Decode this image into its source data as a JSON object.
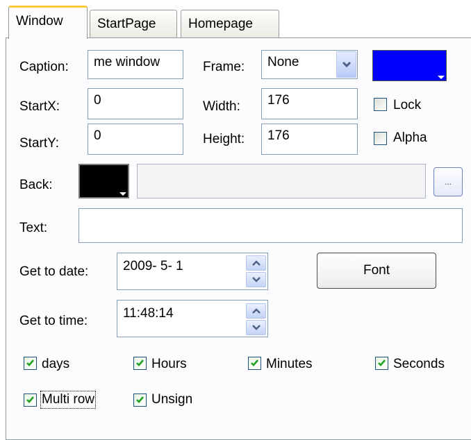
{
  "tabs": [
    {
      "label": "Window",
      "active": true
    },
    {
      "label": "StartPage",
      "active": false
    },
    {
      "label": "Homepage",
      "active": false
    }
  ],
  "caption": {
    "label": "Caption:",
    "value": "me window"
  },
  "frame": {
    "label": "Frame:",
    "selected": "None"
  },
  "frame_color": "#0000ff",
  "startx": {
    "label": "StartX:",
    "value": "0"
  },
  "starty": {
    "label": "StartY:",
    "value": "0"
  },
  "width": {
    "label": "Width:",
    "value": "176"
  },
  "height": {
    "label": "Height:",
    "value": "176"
  },
  "lock": {
    "label": "Lock",
    "checked": false
  },
  "alpha": {
    "label": "Alpha",
    "checked": false
  },
  "back": {
    "label": "Back:",
    "color": "#000000",
    "path": "",
    "browse_label": "..."
  },
  "text": {
    "label": "Text:",
    "value": ""
  },
  "get_to_date": {
    "label": "Get to date:",
    "value": "2009-  5-  1"
  },
  "get_to_time": {
    "label": "Get to time:",
    "value": "11:48:14"
  },
  "font_button": "Font",
  "checkboxes": [
    {
      "label": "days",
      "checked": true
    },
    {
      "label": "Hours",
      "checked": true
    },
    {
      "label": "Minutes",
      "checked": true
    },
    {
      "label": "Seconds",
      "checked": true
    },
    {
      "label": "Multi row",
      "checked": true
    },
    {
      "label": "Unsign",
      "checked": true
    }
  ]
}
